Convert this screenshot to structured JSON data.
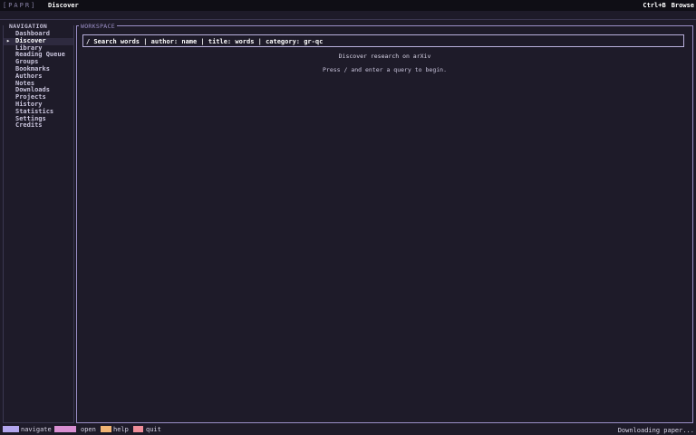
{
  "app": {
    "brand": "[PAPR]",
    "screen_title": "Discover",
    "shortcut_key": "Ctrl+B",
    "shortcut_action": "Browse"
  },
  "sidebar": {
    "label": "NAVIGATION",
    "active_marker": "▸",
    "items": [
      {
        "label": "Dashboard",
        "active": false
      },
      {
        "label": "Discover",
        "active": true
      },
      {
        "label": "Library",
        "active": false
      },
      {
        "label": "Reading Queue",
        "active": false
      },
      {
        "label": "Groups",
        "active": false
      },
      {
        "label": "Bookmarks",
        "active": false
      },
      {
        "label": "Authors",
        "active": false
      },
      {
        "label": "Notes",
        "active": false
      },
      {
        "label": "Downloads",
        "active": false
      },
      {
        "label": "Projects",
        "active": false
      },
      {
        "label": "History",
        "active": false
      },
      {
        "label": "Statistics",
        "active": false
      },
      {
        "label": "Settings",
        "active": false
      },
      {
        "label": "Credits",
        "active": false
      }
    ]
  },
  "workspace": {
    "label": "WORKSPACE",
    "search_value": "/ Search words | author: name | title: words | category: gr-qc",
    "heading": "Discover research on arXiv",
    "subtext": "Press / and enter a query to begin."
  },
  "statusbar": {
    "keys": [
      {
        "label": "navigate",
        "color": "#b3a6ee"
      },
      {
        "label": "open",
        "color": "#d98fd2"
      },
      {
        "label": "help",
        "color": "#f1b474"
      },
      {
        "label": "quit",
        "color": "#ef8e9a"
      }
    ],
    "right_text": "Downloading paper..."
  }
}
